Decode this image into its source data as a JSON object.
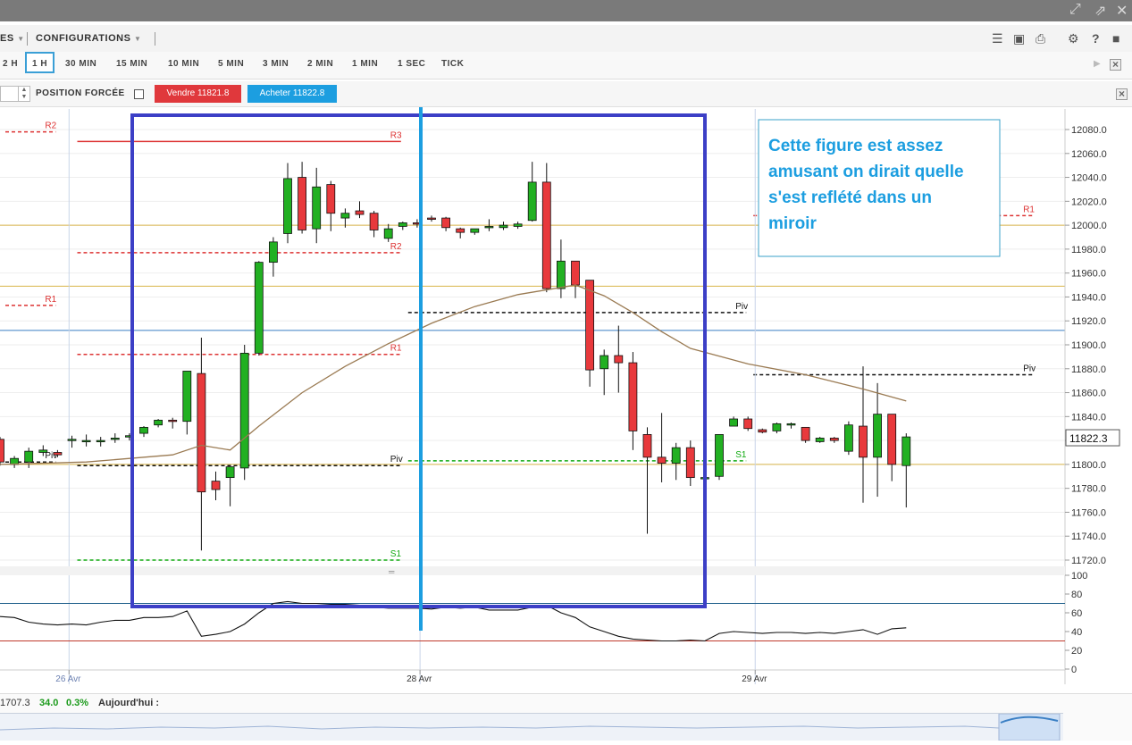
{
  "toolbar": {
    "left_menu": "ES",
    "configurations": "CONFIGURATIONS"
  },
  "timeframes": [
    "2 H",
    "1 H",
    "30 MIN",
    "15 MIN",
    "10 MIN",
    "5 MIN",
    "3 MIN",
    "2 MIN",
    "1 MIN",
    "1 SEC",
    "TICK"
  ],
  "active_timeframe": "1 H",
  "order": {
    "forced_position_label": "POSITION FORCÉE",
    "sell_label": "Vendre 11821.8",
    "buy_label": "Acheter 11822.8"
  },
  "footer": {
    "price": "1707.3",
    "change": "34.0",
    "change_pct": "0.3%",
    "today_label": "Aujourd'hui :"
  },
  "colors": {
    "bull": "#22b022",
    "bear": "#e8393c",
    "annotation_blue": "#1c9ee0",
    "box_blue": "#3c3fc6",
    "accent": "#3a9fd6"
  },
  "chart_data": {
    "type": "candlestick",
    "price_axis": {
      "min": 11720,
      "max": 12080,
      "ticks": [
        "12080.0",
        "12060.0",
        "12040.0",
        "12020.0",
        "12000.0",
        "11980.0",
        "11960.0",
        "11940.0",
        "11920.0",
        "11900.0",
        "11880.0",
        "11860.0",
        "11840.0",
        "11820.0",
        "11800.0",
        "11780.0",
        "11760.0",
        "11740.0",
        "11720.0"
      ],
      "current_price": "11822.3"
    },
    "x_labels": [
      "26 Avr",
      "28 Avr",
      "29 Avr"
    ],
    "candles": [
      {
        "o": 11821,
        "h": 11823,
        "l": 11799,
        "c": 11802
      },
      {
        "o": 11800,
        "h": 11807,
        "l": 11797,
        "c": 11805
      },
      {
        "o": 11802,
        "h": 11814,
        "l": 11797,
        "c": 11811
      },
      {
        "o": 11810,
        "h": 11816,
        "l": 11807,
        "c": 11812
      },
      {
        "o": 11810,
        "h": 11812,
        "l": 11806,
        "c": 11808
      },
      {
        "o": 11820,
        "h": 11824,
        "l": 11814,
        "c": 11821
      },
      {
        "o": 11820,
        "h": 11825,
        "l": 11815,
        "c": 11820
      },
      {
        "o": 11820,
        "h": 11823,
        "l": 11815,
        "c": 11820
      },
      {
        "o": 11822,
        "h": 11826,
        "l": 11818,
        "c": 11822
      },
      {
        "o": 11823,
        "h": 11826,
        "l": 11820,
        "c": 11824
      },
      {
        "o": 11826,
        "h": 11832,
        "l": 11823,
        "c": 11831
      },
      {
        "o": 11833,
        "h": 11838,
        "l": 11831,
        "c": 11837
      },
      {
        "o": 11837,
        "h": 11839,
        "l": 11830,
        "c": 11836
      },
      {
        "o": 11836,
        "h": 11844,
        "l": 11825,
        "c": 11878
      },
      {
        "o": 11876,
        "h": 11906,
        "l": 11728,
        "c": 11777
      },
      {
        "o": 11786,
        "h": 11794,
        "l": 11770,
        "c": 11779
      },
      {
        "o": 11789,
        "h": 11794,
        "l": 11765,
        "c": 11798
      },
      {
        "o": 11797,
        "h": 11900,
        "l": 11787,
        "c": 11893
      },
      {
        "o": 11893,
        "h": 11970,
        "l": 11891,
        "c": 11969
      },
      {
        "o": 11969,
        "h": 11990,
        "l": 11957,
        "c": 11986
      },
      {
        "o": 11993,
        "h": 12052,
        "l": 11985,
        "c": 12039
      },
      {
        "o": 12040,
        "h": 12053,
        "l": 11993,
        "c": 11996
      },
      {
        "o": 11997,
        "h": 12048,
        "l": 11985,
        "c": 12032
      },
      {
        "o": 12034,
        "h": 12037,
        "l": 11995,
        "c": 12010
      },
      {
        "o": 12006,
        "h": 12014,
        "l": 11998,
        "c": 12010
      },
      {
        "o": 12012,
        "h": 12020,
        "l": 12006,
        "c": 12009
      },
      {
        "o": 12010,
        "h": 12012,
        "l": 11990,
        "c": 11996
      },
      {
        "o": 11989,
        "h": 12001,
        "l": 11986,
        "c": 11997
      },
      {
        "o": 11999,
        "h": 12003,
        "l": 11996,
        "c": 12002
      },
      {
        "o": 12002,
        "h": 12005,
        "l": 11998,
        "c": 12001
      },
      {
        "o": 12006,
        "h": 12008,
        "l": 12003,
        "c": 12005
      },
      {
        "o": 12006,
        "h": 12007,
        "l": 11995,
        "c": 11998
      },
      {
        "o": 11997,
        "h": 11998,
        "l": 11989,
        "c": 11994
      },
      {
        "o": 11994,
        "h": 11997,
        "l": 11992,
        "c": 11997
      },
      {
        "o": 11998,
        "h": 12005,
        "l": 11995,
        "c": 11999
      },
      {
        "o": 11998,
        "h": 12003,
        "l": 11996,
        "c": 12000
      },
      {
        "o": 11999,
        "h": 12003,
        "l": 11997,
        "c": 12001
      },
      {
        "o": 12004,
        "h": 12053,
        "l": 12003,
        "c": 12036
      },
      {
        "o": 12036,
        "h": 12052,
        "l": 11944,
        "c": 11947
      },
      {
        "o": 11947,
        "h": 11988,
        "l": 11939,
        "c": 11970
      },
      {
        "o": 11970,
        "h": 11970,
        "l": 11939,
        "c": 11950
      },
      {
        "o": 11954,
        "h": 11954,
        "l": 11865,
        "c": 11879
      },
      {
        "o": 11880,
        "h": 11896,
        "l": 11858,
        "c": 11891
      },
      {
        "o": 11891,
        "h": 11916,
        "l": 11860,
        "c": 11885
      },
      {
        "o": 11885,
        "h": 11894,
        "l": 11812,
        "c": 11828
      },
      {
        "o": 11825,
        "h": 11831,
        "l": 11742,
        "c": 11806
      },
      {
        "o": 11806,
        "h": 11843,
        "l": 11785,
        "c": 11801
      },
      {
        "o": 11801,
        "h": 11818,
        "l": 11787,
        "c": 11814
      },
      {
        "o": 11814,
        "h": 11820,
        "l": 11782,
        "c": 11789
      },
      {
        "o": 11789,
        "h": 11790,
        "l": 11777,
        "c": 11789
      },
      {
        "o": 11790,
        "h": 11825,
        "l": 11787,
        "c": 11825
      },
      {
        "o": 11832,
        "h": 11840,
        "l": 11832,
        "c": 11838
      },
      {
        "o": 11838,
        "h": 11840,
        "l": 11828,
        "c": 11830
      },
      {
        "o": 11829,
        "h": 11830,
        "l": 11826,
        "c": 11827
      },
      {
        "o": 11828,
        "h": 11835,
        "l": 11826,
        "c": 11834
      },
      {
        "o": 11833,
        "h": 11835,
        "l": 11830,
        "c": 11834
      },
      {
        "o": 11831,
        "h": 11831,
        "l": 11818,
        "c": 11820
      },
      {
        "o": 11819,
        "h": 11823,
        "l": 11818,
        "c": 11822
      },
      {
        "o": 11822,
        "h": 11823,
        "l": 11818,
        "c": 11820
      },
      {
        "o": 11811,
        "h": 11836,
        "l": 11808,
        "c": 11833
      },
      {
        "o": 11832,
        "h": 11882,
        "l": 11768,
        "c": 11806
      },
      {
        "o": 11806,
        "h": 11868,
        "l": 11773,
        "c": 11842
      },
      {
        "o": 11842,
        "h": 11842,
        "l": 11786,
        "c": 11800
      },
      {
        "o": 11799,
        "h": 11826,
        "l": 11764,
        "c": 11823
      }
    ],
    "moving_average": [
      {
        "i": 0,
        "v": 11800
      },
      {
        "i": 6,
        "v": 11802
      },
      {
        "i": 12,
        "v": 11808
      },
      {
        "i": 14,
        "v": 11816
      },
      {
        "i": 16,
        "v": 11812
      },
      {
        "i": 18,
        "v": 11832
      },
      {
        "i": 21,
        "v": 11860
      },
      {
        "i": 24,
        "v": 11882
      },
      {
        "i": 27,
        "v": 11901
      },
      {
        "i": 30,
        "v": 11918
      },
      {
        "i": 33,
        "v": 11932
      },
      {
        "i": 36,
        "v": 11942
      },
      {
        "i": 40,
        "v": 11950
      },
      {
        "i": 42,
        "v": 11941
      },
      {
        "i": 44,
        "v": 11927
      },
      {
        "i": 46,
        "v": 11911
      },
      {
        "i": 48,
        "v": 11897
      },
      {
        "i": 52,
        "v": 11884
      },
      {
        "i": 56,
        "v": 11875
      },
      {
        "i": 60,
        "v": 11863
      },
      {
        "i": 63,
        "v": 11853
      }
    ],
    "levels": [
      {
        "label": "R2",
        "price": 12078,
        "from": 0,
        "to": 4,
        "color": "#d33",
        "dash": true
      },
      {
        "label": "R1",
        "price": 11933,
        "from": 0,
        "to": 4,
        "color": "#d33",
        "dash": true
      },
      {
        "label": "Piv",
        "price": 11802,
        "from": 0,
        "to": 4,
        "color": "#111",
        "dash": true
      },
      {
        "label": "R3",
        "price": 12070,
        "from": 5,
        "to": 28,
        "color": "#d33",
        "dash": false
      },
      {
        "label": "R2",
        "price": 11977,
        "from": 5,
        "to": 28,
        "color": "#d33",
        "dash": true
      },
      {
        "label": "R1",
        "price": 11892,
        "from": 5,
        "to": 28,
        "color": "#d33",
        "dash": true
      },
      {
        "label": "Piv",
        "price": 11799,
        "from": 5,
        "to": 28,
        "color": "#111",
        "dash": true
      },
      {
        "label": "S1",
        "price": 11720,
        "from": 5,
        "to": 28,
        "color": "#1a1",
        "dash": true
      },
      {
        "label": "Piv",
        "price": 11927,
        "from": 28,
        "to": 52,
        "color": "#111",
        "dash": true
      },
      {
        "label": "S1",
        "price": 11803,
        "from": 28,
        "to": 52,
        "color": "#1a1",
        "dash": true
      },
      {
        "label": "R1",
        "price": 12008,
        "from": 52,
        "to": 72,
        "color": "#d33",
        "dash": true
      },
      {
        "label": "Piv",
        "price": 11875,
        "from": 52,
        "to": 72,
        "color": "#111",
        "dash": true
      }
    ],
    "horizontal_lines": [
      {
        "price": 12000,
        "color": "#d8b44a"
      },
      {
        "price": 11949,
        "color": "#d8b44a"
      },
      {
        "price": 11800,
        "color": "#d8b44a"
      },
      {
        "price": 11912,
        "color": "#3a7fc4"
      }
    ],
    "oscillator": {
      "ticks": [
        "100",
        "80",
        "60",
        "40",
        "20",
        "0"
      ],
      "upper": 70,
      "lower": 30,
      "points": [
        56,
        55,
        50,
        48,
        47,
        48,
        47,
        50,
        52,
        52,
        55,
        55,
        56,
        62,
        35,
        37,
        40,
        48,
        60,
        70,
        72,
        70,
        70,
        69,
        69,
        68,
        66,
        65,
        65,
        65,
        64,
        66,
        65,
        66,
        63,
        63,
        63,
        66,
        68,
        60,
        55,
        45,
        40,
        35,
        32,
        31,
        30,
        30,
        31,
        30,
        38,
        40,
        39,
        38,
        39,
        39,
        38,
        39,
        38,
        40,
        42,
        37,
        43,
        44
      ]
    },
    "annotation": "Cette figure est assez amusant on dirait quelle s'est reflété dans un miroir"
  }
}
